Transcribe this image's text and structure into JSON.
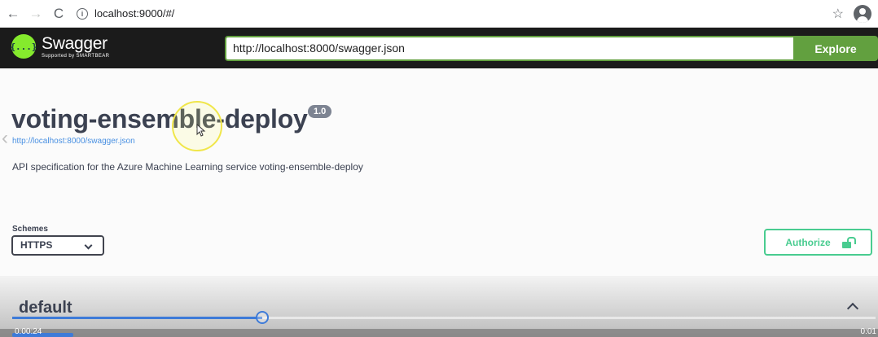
{
  "browser": {
    "back_glyph": "←",
    "forward_glyph": "→",
    "reload_glyph": "C",
    "info_glyph": "i",
    "url": "localhost:9000/#/",
    "star_glyph": "☆"
  },
  "swagger": {
    "logo_glyph": "{...}",
    "logo_name": "Swagger",
    "logo_sub": "Supported by SMARTBEAR",
    "spec_url_value": "http://localhost:8000/swagger.json",
    "explore_label": "Explore"
  },
  "info": {
    "title": "voting-ensemble-deploy",
    "version": "1.0",
    "spec_link": "http://localhost:8000/swagger.json",
    "description": "API specification for the Azure Machine Learning service voting-ensemble-deploy",
    "left_arrow_glyph": "‹"
  },
  "schemes": {
    "label": "Schemes",
    "selected": "HTTPS"
  },
  "authorize": {
    "label": "Authorize"
  },
  "operations": {
    "tag": "default"
  },
  "video": {
    "elapsed": "0:00:24",
    "total": "0:01",
    "progress_fraction": 0.29
  },
  "colors": {
    "accent_green": "#62a03f",
    "authorize_green": "#49cc90",
    "link_blue": "#4990e2",
    "progress_blue": "#3e7bd8"
  },
  "icons": [
    "back-arrow-icon",
    "forward-arrow-icon",
    "reload-icon",
    "info-icon",
    "star-icon",
    "account-icon",
    "swagger-logo-icon",
    "lock-icon",
    "chevron-down-icon",
    "chevron-up-icon",
    "mouse-cursor-icon"
  ]
}
